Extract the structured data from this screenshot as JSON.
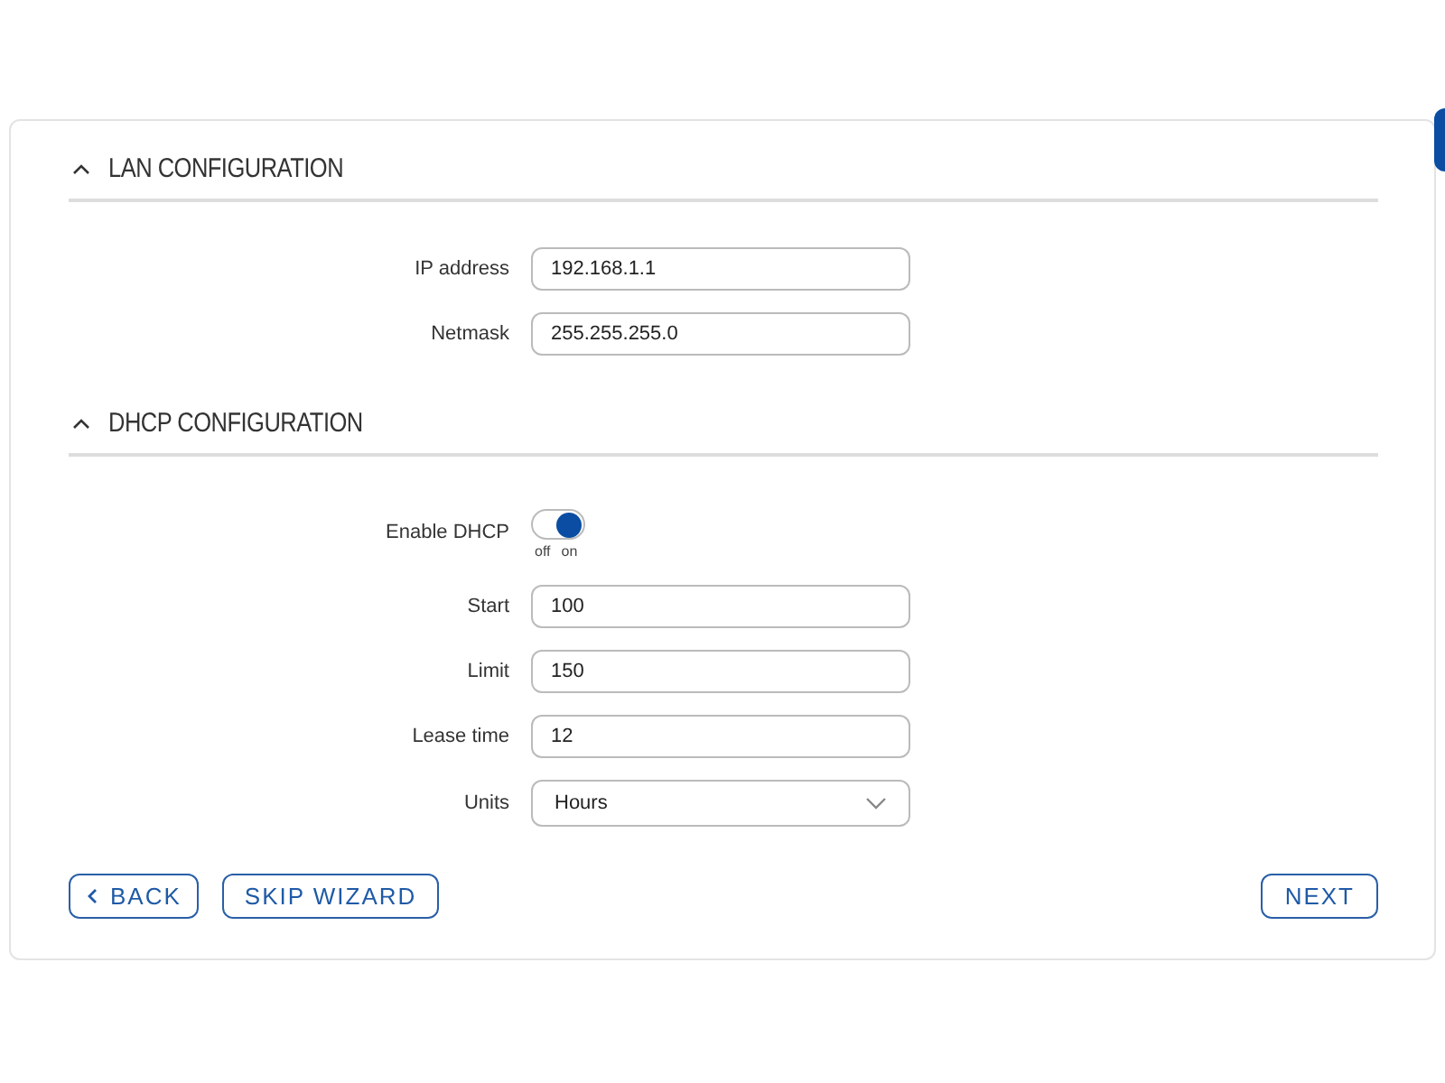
{
  "sections": [
    {
      "title": "LAN CONFIGURATION",
      "expanded": true,
      "fields": [
        {
          "kind": "text",
          "label": "IP address",
          "value": "192.168.1.1"
        },
        {
          "kind": "text",
          "label": "Netmask",
          "value": "255.255.255.0"
        }
      ]
    },
    {
      "title": "DHCP CONFIGURATION",
      "expanded": true,
      "fields": [
        {
          "kind": "toggle",
          "label": "Enable DHCP",
          "on": true,
          "off_text": "off",
          "on_text": "on"
        },
        {
          "kind": "text",
          "label": "Start",
          "value": "100"
        },
        {
          "kind": "text",
          "label": "Limit",
          "value": "150"
        },
        {
          "kind": "text",
          "label": "Lease time",
          "value": "12"
        },
        {
          "kind": "select",
          "label": "Units",
          "value": "Hours"
        }
      ]
    }
  ],
  "buttons": {
    "back": "BACK",
    "skip": "SKIP WIZARD",
    "next": "NEXT"
  }
}
